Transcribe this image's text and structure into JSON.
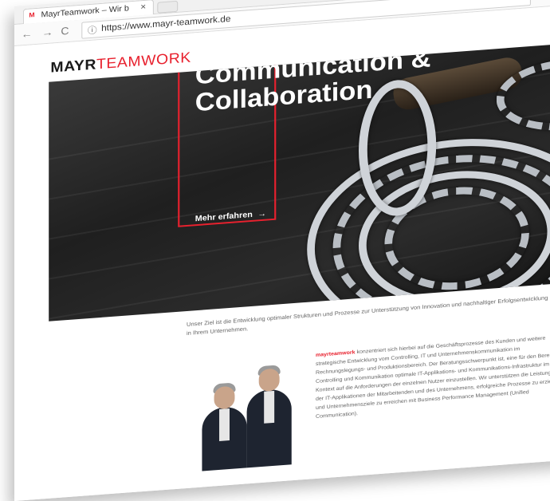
{
  "browser": {
    "tab_title": "MayrTeamwork – Wir b",
    "tab_close": "×",
    "favicon": "M",
    "url": "https://www.mayr-teamwork.de",
    "back_icon": "arrow-left",
    "forward_icon": "arrow-right",
    "reload_icon": "reload",
    "info_icon": "info"
  },
  "logo": {
    "part1": "MAYR",
    "part2": "TEAMWORK"
  },
  "hero": {
    "heading_line1": "Communication &",
    "heading_line2": "Collaboration",
    "cta": "Mehr erfahren",
    "cta_arrow": "→"
  },
  "intro": "Unser Ziel ist die Entwicklung optimaler Strukturen und Prozesse zur Unterstützung von Innovation und nachhaltiger Erfolgsentwicklung in Ihrem Unternehmen.",
  "body": {
    "brand": "mayrteamwork",
    "text": " konzentriert sich hierbei auf die Geschäftsprozesse des Kunden und weitere strategische Entwicklung vom Controlling, IT und Unternehmenskommunikation im Rechnungslegungs- und Produktionsbereich. Der Beratungsschwerpunkt ist, eine für den Bereich Controlling und Kommunikation optimale IT-Applikations- und Kommunikations-Infrastruktur im Kontext auf die Anforderungen der einzelnen Nutzer einzustellen. Wir unterstützen die Leistungen der IT-Applikationen der Mitarbeitenden und des Unternehmens, erfolgreiche Prozesse zu erzielen und Unternehmensziele zu erreichen mit Business Performance Management (Unified Communication)."
  },
  "colors": {
    "brand_red": "#e8212e",
    "dark": "#1a1a1a"
  }
}
